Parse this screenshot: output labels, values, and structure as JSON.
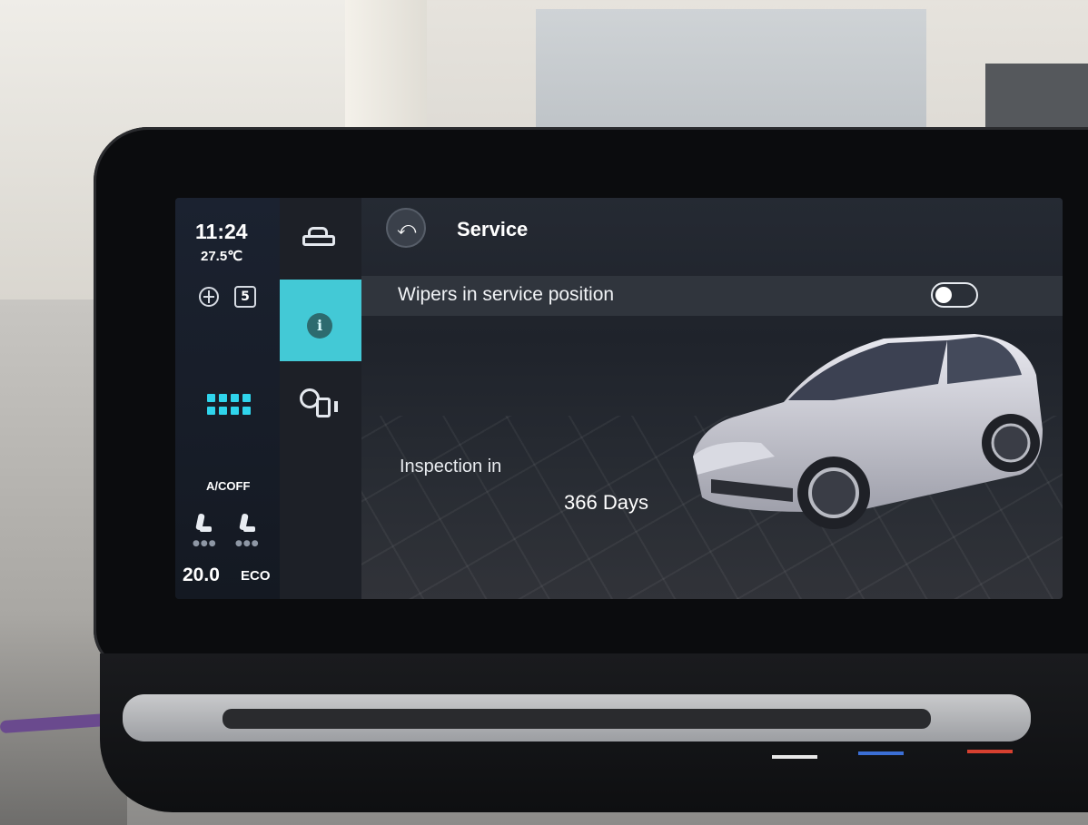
{
  "status": {
    "time": "11:24",
    "outside_temp": "27.5℃",
    "badge_number": "5",
    "ac_label": "A/COFF",
    "temp_setpoint": "20.0",
    "mode": "ECO"
  },
  "nav": {
    "items": [
      {
        "icon": "car-icon"
      },
      {
        "icon": "info-icon",
        "glyph": "i",
        "active": true
      },
      {
        "icon": "service-icon"
      }
    ]
  },
  "header": {
    "back_glyph": "⤺",
    "title": "Service"
  },
  "settings": {
    "wipers_label": "Wipers in service position",
    "wipers_on": false
  },
  "inspection": {
    "label": "Inspection in",
    "value": "366 Days"
  },
  "colors": {
    "accent": "#43c9d6",
    "fan_level": "#2fd4ec"
  }
}
